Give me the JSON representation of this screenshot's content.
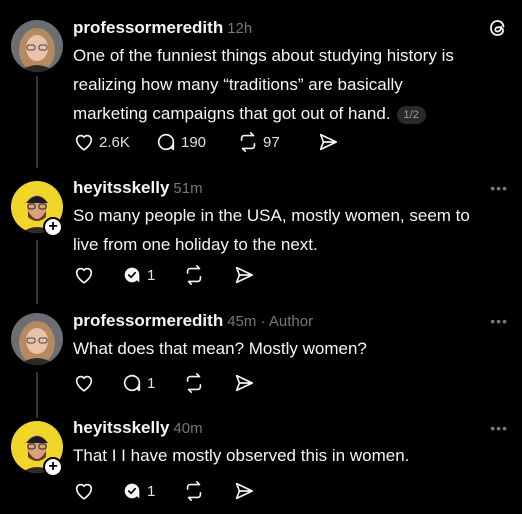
{
  "posts": [
    {
      "username": "professormeredith",
      "time": "12h",
      "lines": [
        "One of the funniest things about studying history is",
        "realizing how many “traditions” are basically",
        "marketing campaigns that got out of hand."
      ],
      "page_indicator": "1/2",
      "likes": "2.6K",
      "replies": "190",
      "reposts": "97",
      "has_threads_logo": true
    },
    {
      "username": "heyitsskelly",
      "time": "51m",
      "lines": [
        "So many people in the USA, mostly women, seem to",
        "live from one holiday to the next."
      ],
      "replies": "1"
    },
    {
      "username": "professormeredith",
      "time": "45m · Author",
      "lines": [
        "What does that mean? Mostly women?"
      ],
      "replies": "1"
    },
    {
      "username": "heyitsskelly",
      "time": "40m",
      "lines": [
        "That I I have mostly observed this in women."
      ],
      "replies": "1"
    }
  ],
  "icons": {
    "like": "heart-icon",
    "reply": "comment-icon",
    "repost": "repost-icon",
    "share": "share-icon",
    "more": "more-icon",
    "logo": "threads-logo-icon"
  },
  "colors": {
    "background": "#000000",
    "text": "#f3f5f7",
    "muted": "#777777"
  },
  "more_glyph": "•••"
}
